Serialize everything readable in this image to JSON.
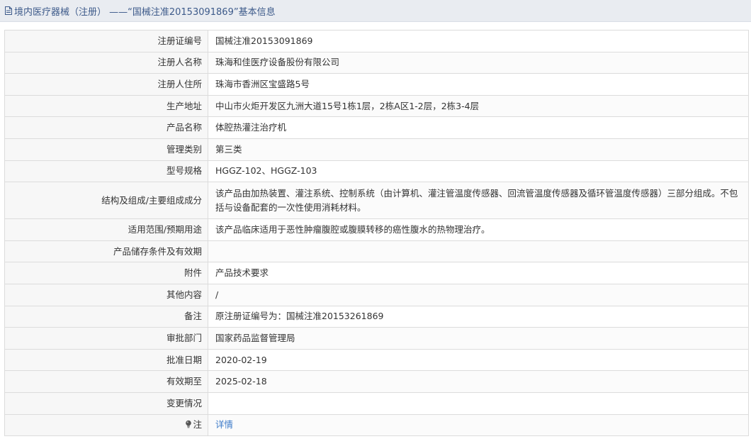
{
  "header": {
    "title": "境内医疗器械（注册） ——“国械注准20153091869”基本信息"
  },
  "rows": [
    {
      "label": "注册证编号",
      "value": "国械注准20153091869"
    },
    {
      "label": "注册人名称",
      "value": "珠海和佳医疗设备股份有限公司"
    },
    {
      "label": "注册人住所",
      "value": "珠海市香洲区宝盛路5号"
    },
    {
      "label": "生产地址",
      "value": "中山市火炬开发区九洲大道15号1栋1层，2栋A区1-2层，2栋3-4层"
    },
    {
      "label": "产品名称",
      "value": "体腔热灌注治疗机"
    },
    {
      "label": "管理类别",
      "value": "第三类"
    },
    {
      "label": "型号规格",
      "value": "HGGZ-102、HGGZ-103"
    },
    {
      "label": "结构及组成/主要组成成分",
      "value": "该产品由加热装置、灌注系统、控制系统（由计算机、灌注管温度传感器、回流管温度传感器及循环管温度传感器）三部分组成。不包括与设备配套的一次性使用消耗材料。"
    },
    {
      "label": "适用范围/预期用途",
      "value": "该产品临床适用于恶性肿瘤腹腔或腹膜转移的癌性腹水的热物理治疗。"
    },
    {
      "label": "产品储存条件及有效期",
      "value": ""
    },
    {
      "label": "附件",
      "value": "产品技术要求"
    },
    {
      "label": "其他内容",
      "value": "/"
    },
    {
      "label": "备注",
      "value": "原注册证编号为：国械注准20153261869"
    },
    {
      "label": "审批部门",
      "value": "国家药品监督管理局"
    },
    {
      "label": "批准日期",
      "value": "2020-02-19"
    },
    {
      "label": "有效期至",
      "value": "2025-02-18"
    },
    {
      "label": "变更情况",
      "value": ""
    },
    {
      "label": "注",
      "value": "详情",
      "icon": "lightbulb-icon"
    }
  ],
  "colors": {
    "title_text": "#3d5a8a",
    "link": "#3b7ac8",
    "label_bg": "#f7f7f7",
    "border": "#dcdcdc"
  }
}
